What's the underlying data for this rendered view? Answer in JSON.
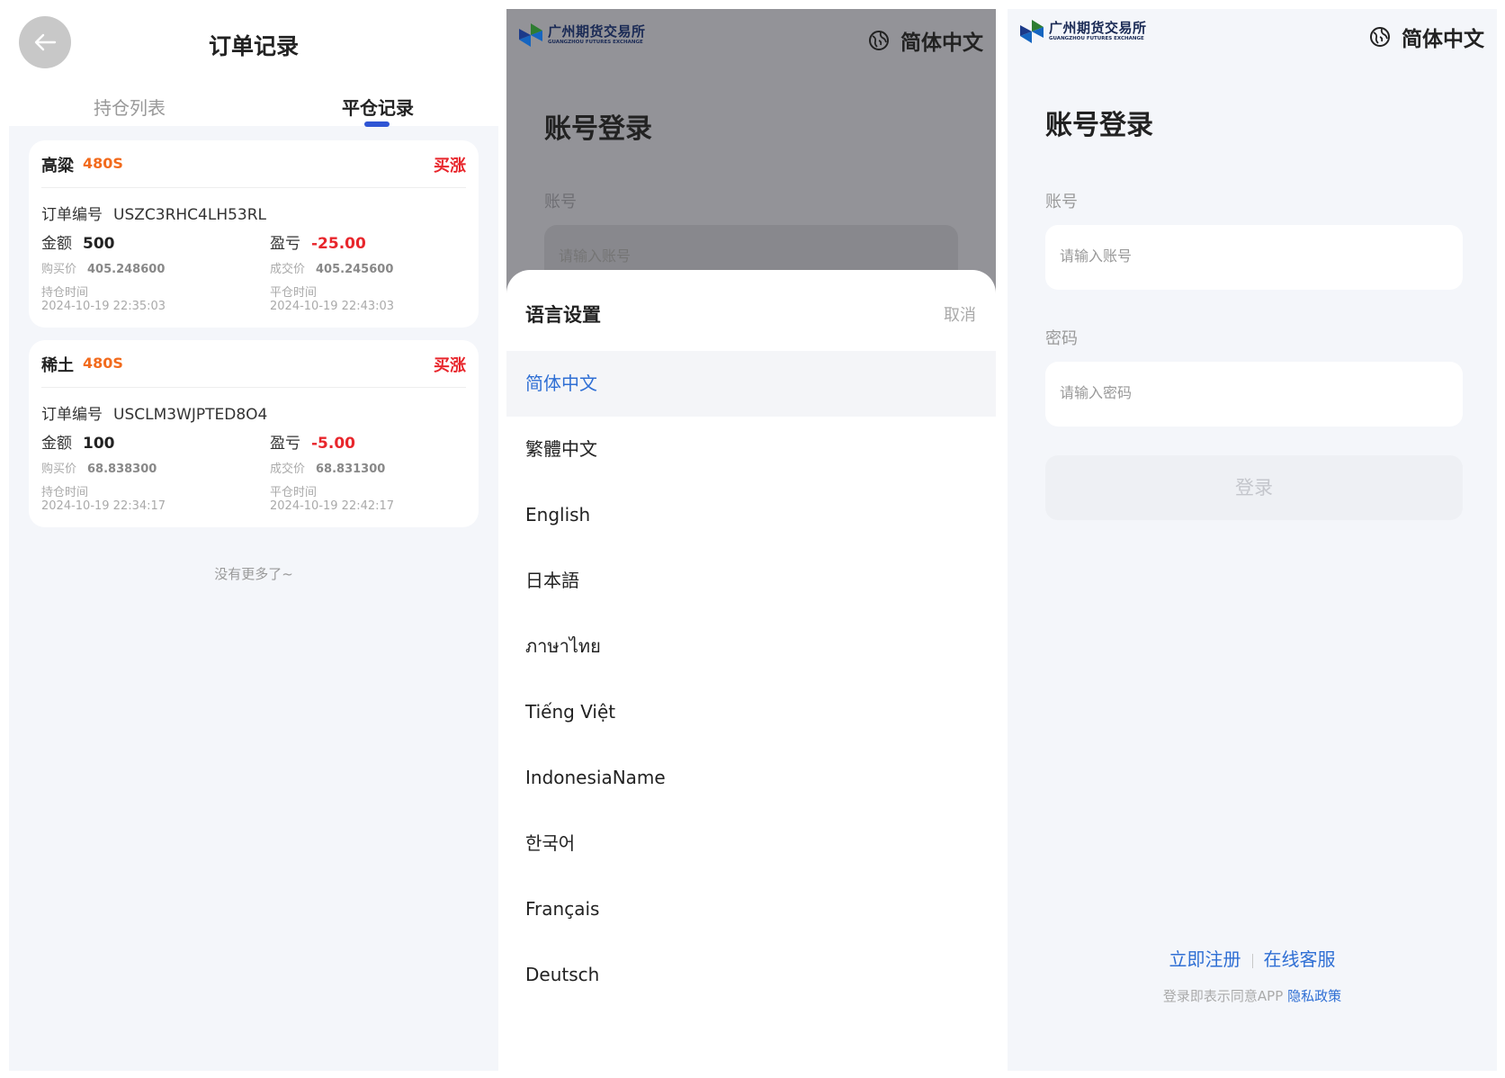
{
  "colors": {
    "accent": "#2f6fd4",
    "tab_indicator": "#2f55d4",
    "up_red": "#e8262c",
    "code_orange": "#f26b1d",
    "overlay": "#939398"
  },
  "orders": {
    "title": "订单记录",
    "tabs": [
      {
        "label": "持仓列表"
      },
      {
        "label": "平仓记录"
      }
    ],
    "active_tab": "平仓记录",
    "items": [
      {
        "name": "高粱",
        "code": "480S",
        "direction": "买涨",
        "order_label": "订单编号",
        "order_no": "USZC3RHC4LH53RL",
        "amount_label": "金额",
        "amount": "500",
        "pnl_label": "盈亏",
        "pnl": "-25.00",
        "buy_label": "购买价",
        "buy_price": "405.248600",
        "deal_label": "成交价",
        "deal_price": "405.245600",
        "hold_label": "持仓时间",
        "hold_time": "2024-10-19 22:35:03",
        "close_label": "平仓时间",
        "close_time": "2024-10-19 22:43:03"
      },
      {
        "name": "稀土",
        "code": "480S",
        "direction": "买涨",
        "order_label": "订单编号",
        "order_no": "USCLM3WJPTED8O4",
        "amount_label": "金额",
        "amount": "100",
        "pnl_label": "盈亏",
        "pnl": "-5.00",
        "buy_label": "购买价",
        "buy_price": "68.838300",
        "deal_label": "成交价",
        "deal_price": "68.831300",
        "hold_label": "持仓时间",
        "hold_time": "2024-10-19 22:34:17",
        "close_label": "平仓时间",
        "close_time": "2024-10-19 22:42:17"
      }
    ],
    "no_more": "没有更多了~"
  },
  "brand": {
    "name_cn": "广州期货交易所",
    "name_en": "GUANGZHOU FUTURES EXCHANGE",
    "icon": "exchange-logo-icon"
  },
  "language_switch": {
    "icon": "globe-icon",
    "label": "简体中文"
  },
  "lang_sheet": {
    "bg_title": "账号登录",
    "bg_account_label": "账号",
    "bg_account_placeholder": "请输入账号",
    "title": "语言设置",
    "cancel": "取消",
    "selected": "简体中文",
    "options": [
      {
        "label": "简体中文"
      },
      {
        "label": "繁體中文"
      },
      {
        "label": "English"
      },
      {
        "label": "日本語"
      },
      {
        "label": "ภาษาไทย"
      },
      {
        "label": "Tiếng Việt"
      },
      {
        "label": "IndonesiaName"
      },
      {
        "label": "한국어"
      },
      {
        "label": "Français"
      },
      {
        "label": "Deutsch"
      }
    ]
  },
  "login": {
    "title": "账号登录",
    "account_label": "账号",
    "account_placeholder": "请输入账号",
    "password_label": "密码",
    "password_placeholder": "请输入密码",
    "submit": "登录",
    "register": "立即注册",
    "service": "在线客服",
    "agree_text": "登录即表示同意APP",
    "privacy": "隐私政策"
  }
}
